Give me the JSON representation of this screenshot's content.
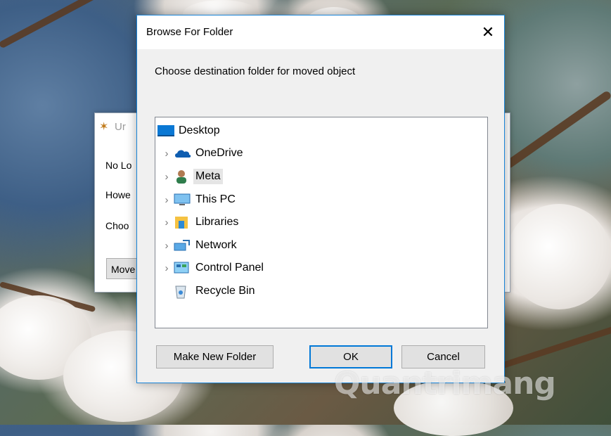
{
  "background_window": {
    "title": "Ur",
    "lines": [
      "No Lo",
      "Howe",
      "Choo"
    ],
    "button_label": "Move"
  },
  "dialog": {
    "title": "Browse For Folder",
    "close_glyph": "✕",
    "prompt": "Choose destination folder for moved object",
    "tree": [
      {
        "label": "Desktop",
        "icon": "desktop-icon",
        "expandable": false,
        "selected": false
      },
      {
        "label": "OneDrive",
        "icon": "onedrive-icon",
        "expandable": true,
        "selected": false
      },
      {
        "label": "Meta",
        "icon": "user-icon",
        "expandable": true,
        "selected": true
      },
      {
        "label": "This PC",
        "icon": "this-pc-icon",
        "expandable": true,
        "selected": false
      },
      {
        "label": "Libraries",
        "icon": "libraries-icon",
        "expandable": true,
        "selected": false
      },
      {
        "label": "Network",
        "icon": "network-icon",
        "expandable": true,
        "selected": false
      },
      {
        "label": "Control Panel",
        "icon": "control-panel-icon",
        "expandable": true,
        "selected": false
      },
      {
        "label": "Recycle Bin",
        "icon": "recycle-bin-icon",
        "expandable": false,
        "selected": false
      }
    ],
    "chevron_glyph": "›",
    "buttons": {
      "make_new_folder": "Make New Folder",
      "ok": "OK",
      "cancel": "Cancel"
    },
    "accent_color": "#0078d7"
  }
}
